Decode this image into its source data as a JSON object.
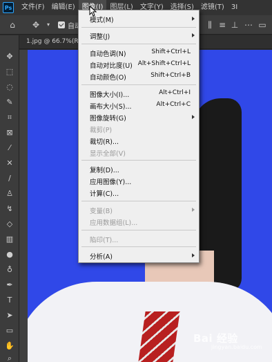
{
  "menubar": {
    "logo": "Ps",
    "items": [
      "文件(F)",
      "编辑(E)",
      "图像(I)",
      "图层(L)",
      "文字(Y)",
      "选择(S)",
      "滤镜(T)",
      "3I"
    ]
  },
  "options": {
    "auto_label": "自动"
  },
  "document": {
    "tab_title": "1.jpg @ 66.7%(RG"
  },
  "image_menu": {
    "mode": "模式(M)",
    "adjust": "调整(J)",
    "auto_tone": "自动色调(N)",
    "auto_tone_sc": "Shift+Ctrl+L",
    "auto_contrast": "自动对比度(U)",
    "auto_contrast_sc": "Alt+Shift+Ctrl+L",
    "auto_color": "自动颜色(O)",
    "auto_color_sc": "Shift+Ctrl+B",
    "image_size": "图像大小(I)...",
    "image_size_sc": "Alt+Ctrl+I",
    "canvas_size": "画布大小(S)...",
    "canvas_size_sc": "Alt+Ctrl+C",
    "rotation": "图像旋转(G)",
    "crop": "裁剪(P)",
    "trim": "裁切(R)...",
    "reveal_all": "显示全部(V)",
    "duplicate": "复制(D)...",
    "apply_image": "应用图像(Y)...",
    "calculations": "计算(C)...",
    "variables": "变量(B)",
    "apply_data_set": "应用数据组(L)...",
    "trap": "陷印(T)...",
    "analysis": "分析(A)"
  },
  "watermark": {
    "big": "Bai 经验",
    "small": "jingyan.baidu.com"
  }
}
